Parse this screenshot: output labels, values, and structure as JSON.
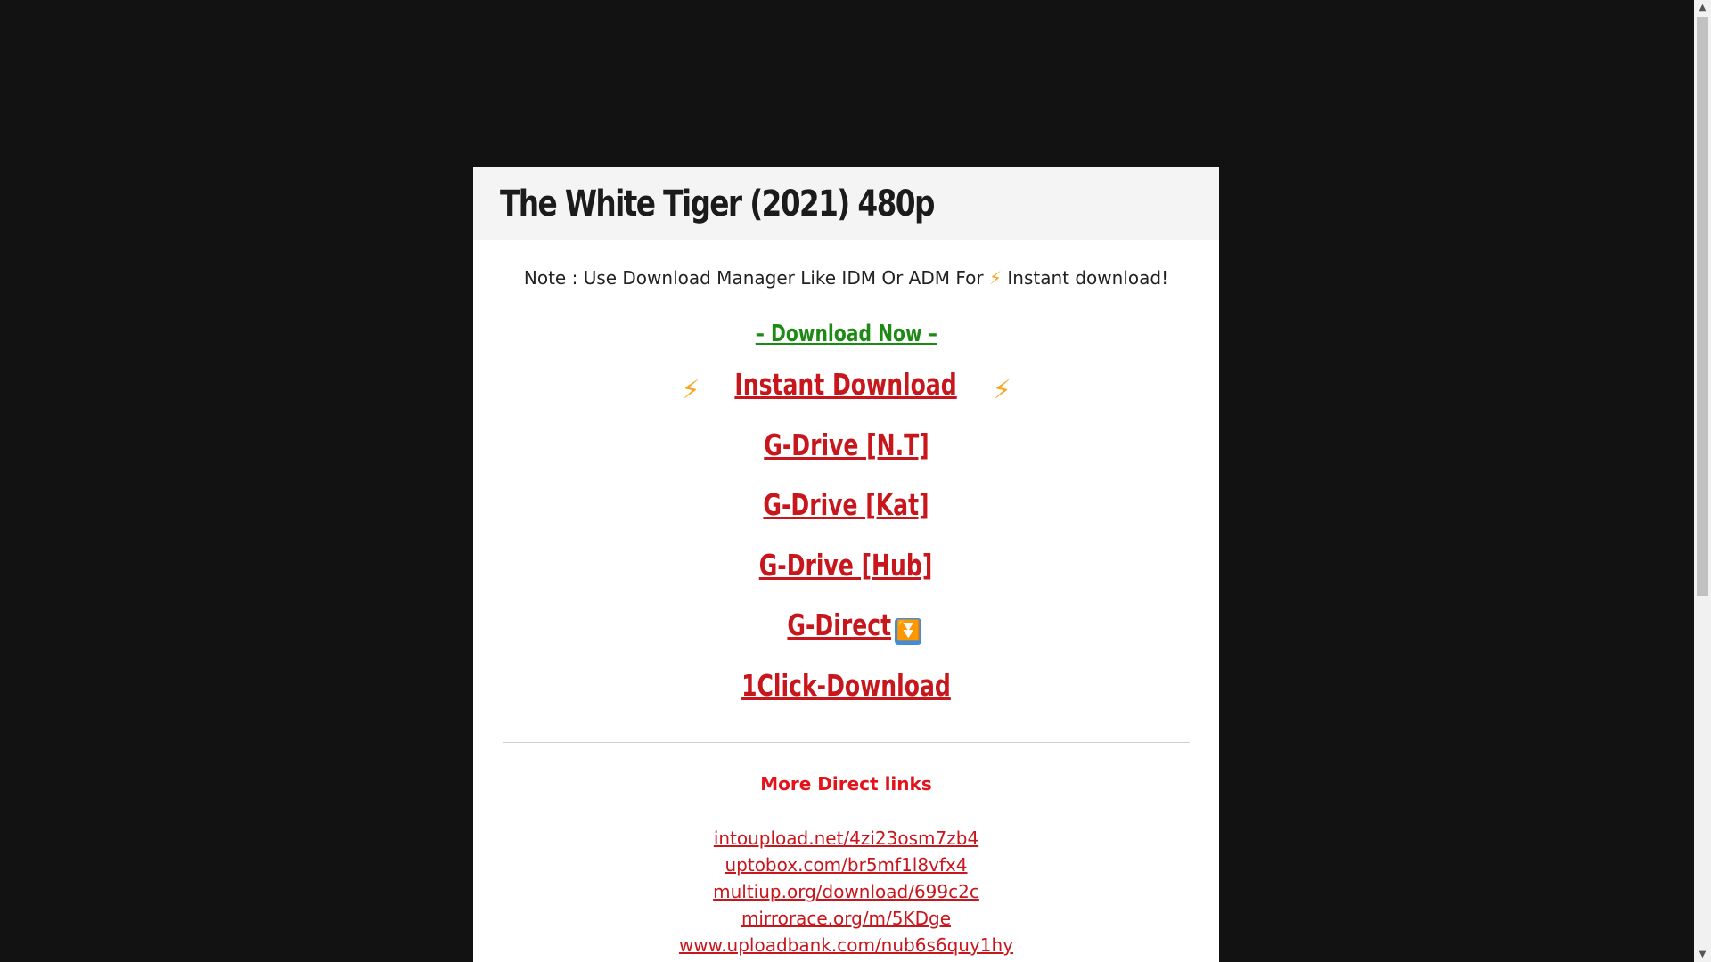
{
  "page": {
    "title": "The White Tiger (2021) 480p"
  },
  "note": {
    "prefix": "Note : Use Download Manager Like IDM Or ADM For ",
    "bolt": "⚡",
    "suffix": " Instant download!"
  },
  "download_now": "– Download Now –",
  "links": {
    "instant_download": " Instant Download ",
    "instant_bolt": "⚡",
    "gdrive_nt": "G-Drive [N.T]",
    "gdrive_kat": "G-Drive [Kat]",
    "gdrive_hub": "G-Drive [Hub]",
    "gdirect": " G-Direct ",
    "gdirect_icon": "⏬",
    "oneclick": "1Click-Download"
  },
  "more": {
    "heading": "More Direct links",
    "mirrors": [
      "intoupload.net/4zi23osm7zb4",
      "uptobox.com/br5mf1l8vfx4",
      "multiup.org/download/699c2c",
      "mirrorace.org/m/5KDge",
      "www.uploadbank.com/nub6s6quy1hy"
    ]
  },
  "colors": {
    "background": "#121212",
    "link_red": "#c8161d",
    "download_now_green": "#1e8a16",
    "heading_red": "#e3131b",
    "bolt": "#f5a623"
  },
  "icons": {
    "bolt": "lightning-bolt-icon",
    "gdirect": "fast-down-arrow-icon"
  }
}
